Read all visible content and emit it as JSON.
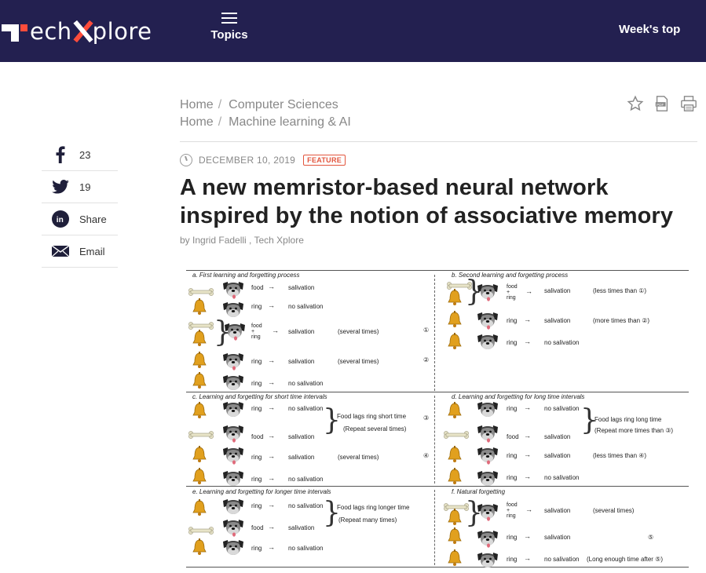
{
  "header": {
    "logo_text_1": "ech",
    "logo_text_2": "plore",
    "topics_label": "Topics",
    "weeks_top_label": "Week's top"
  },
  "breadcrumbs": [
    {
      "home": "Home",
      "category": "Computer Sciences"
    },
    {
      "home": "Home",
      "category": "Machine learning & AI"
    }
  ],
  "share": {
    "facebook_count": "23",
    "twitter_count": "19",
    "linkedin_label": "Share",
    "email_label": "Email"
  },
  "article": {
    "date": "DECEMBER 10, 2019",
    "badge": "FEATURE",
    "title": "A new memristor-based neural network inspired by the notion of associative memory",
    "byline": "by Ingrid Fadelli , Tech Xplore"
  },
  "figure": {
    "panels": {
      "a": "a. First learning and forgetting process",
      "b": "b. Second learning and forgetting process",
      "c": "c. Learning and forgetting for short time intervals",
      "d": "d. Learning and forgetting for long time intervals",
      "e": "e. Learning and forgetting for longer time intervals",
      "f": "f. Natural forgetting"
    },
    "labels": {
      "food": "food",
      "ring": "ring",
      "food_ring": "food\n+\nring",
      "salivation": "salivation",
      "no_salivation": "no salivation",
      "several_times": "(several times)",
      "less_times_1": "(less times than ①)",
      "more_times_2": "(more times than ②)",
      "less_times_4": "(less times than ④)",
      "short_time": "Food lags ring short time",
      "repeat_several": "(Repeat several times)",
      "long_time": "Food lags ring long time",
      "repeat_more": "(Repeat more times than ③)",
      "longer_time": "Food lags ring longer time",
      "repeat_many": "(Repeat many times)",
      "long_enough": "(Long enough time after ⑤)",
      "n1": "①",
      "n2": "②",
      "n3": "③",
      "n4": "④",
      "n5": "⑤"
    }
  }
}
